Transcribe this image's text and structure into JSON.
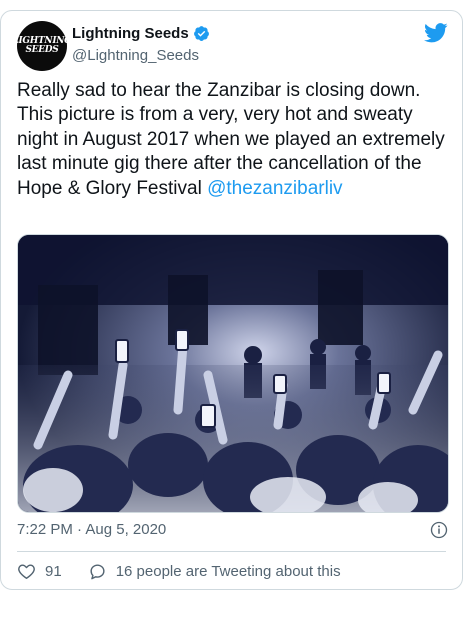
{
  "tweet": {
    "avatar_text": [
      "LIGHTNING",
      "SEEDS"
    ],
    "display_name": "Lightning Seeds",
    "handle": "@Lightning_Seeds",
    "verified_icon": "verified-badge-icon",
    "text": "Really sad to hear the Zanzibar is closing down. This picture is from a very, very hot and sweaty night in August 2017 when we played an extremely last minute gig there after the cancellation of the Hope & Glory Festival ",
    "mention": "@thezanzibarliv",
    "timestamp": "7:22 PM · Aug 5, 2020",
    "likes": "91",
    "reply_text": "16 people are Tweeting about this"
  },
  "colors": {
    "accent": "#1d9bf0",
    "text": "#0f1419",
    "muted": "#536471",
    "border": "#cfd9de"
  },
  "icons": {
    "brand": "twitter-bird-icon",
    "info": "info-icon",
    "like": "heart-icon",
    "reply": "speech-bubble-icon"
  }
}
